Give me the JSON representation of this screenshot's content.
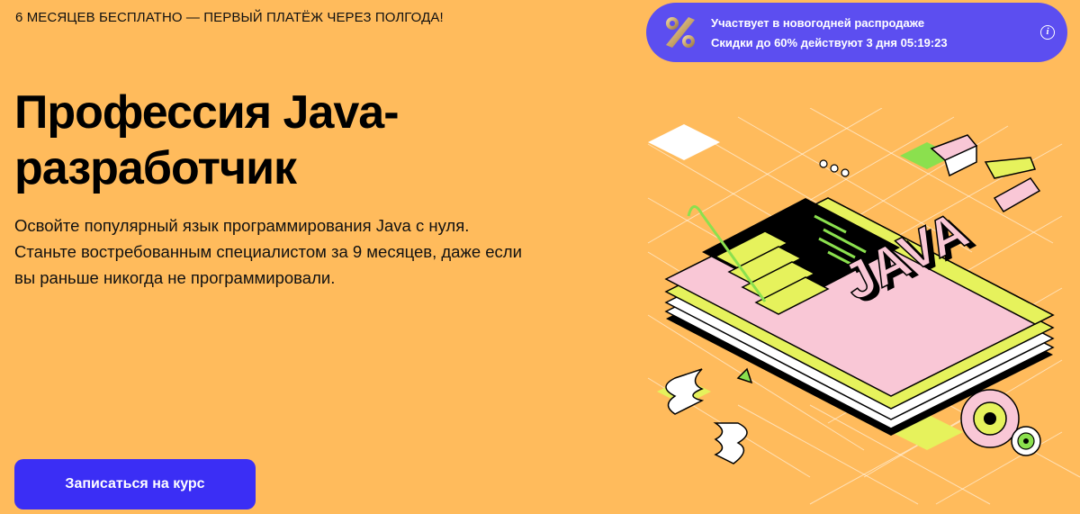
{
  "promo": {
    "text": "6 МЕСЯЦЕВ БЕСПЛАТНО — ПЕРВЫЙ ПЛАТЁЖ ЧЕРЕЗ ПОЛГОДА!"
  },
  "sale": {
    "badge_icon": "percent-icon",
    "line1": "Участвует в новогодней распродаже",
    "line2_prefix": "Скидки до ",
    "discount": "60%",
    "line2_mid": " действуют ",
    "days": "3 дня",
    "timer": "05:19:23",
    "info_icon": "info-icon"
  },
  "hero": {
    "title_line1": "Профессия Java-",
    "title_line2": "разработчик",
    "description": [
      "Освойте популярный язык программирования Java с нуля.",
      "Станьте востребованным специалистом за 9 месяцев, даже если",
      "вы раньше никогда не программировали."
    ],
    "cta_label": "Записаться на курс",
    "illustration_text": "JAVA"
  },
  "colors": {
    "background": "#FFBB5C",
    "banner": "#5C4EF0",
    "cta": "#3B2EF5",
    "pink": "#F9C7D6",
    "lime": "#E6F25C",
    "green": "#8BE04E"
  }
}
